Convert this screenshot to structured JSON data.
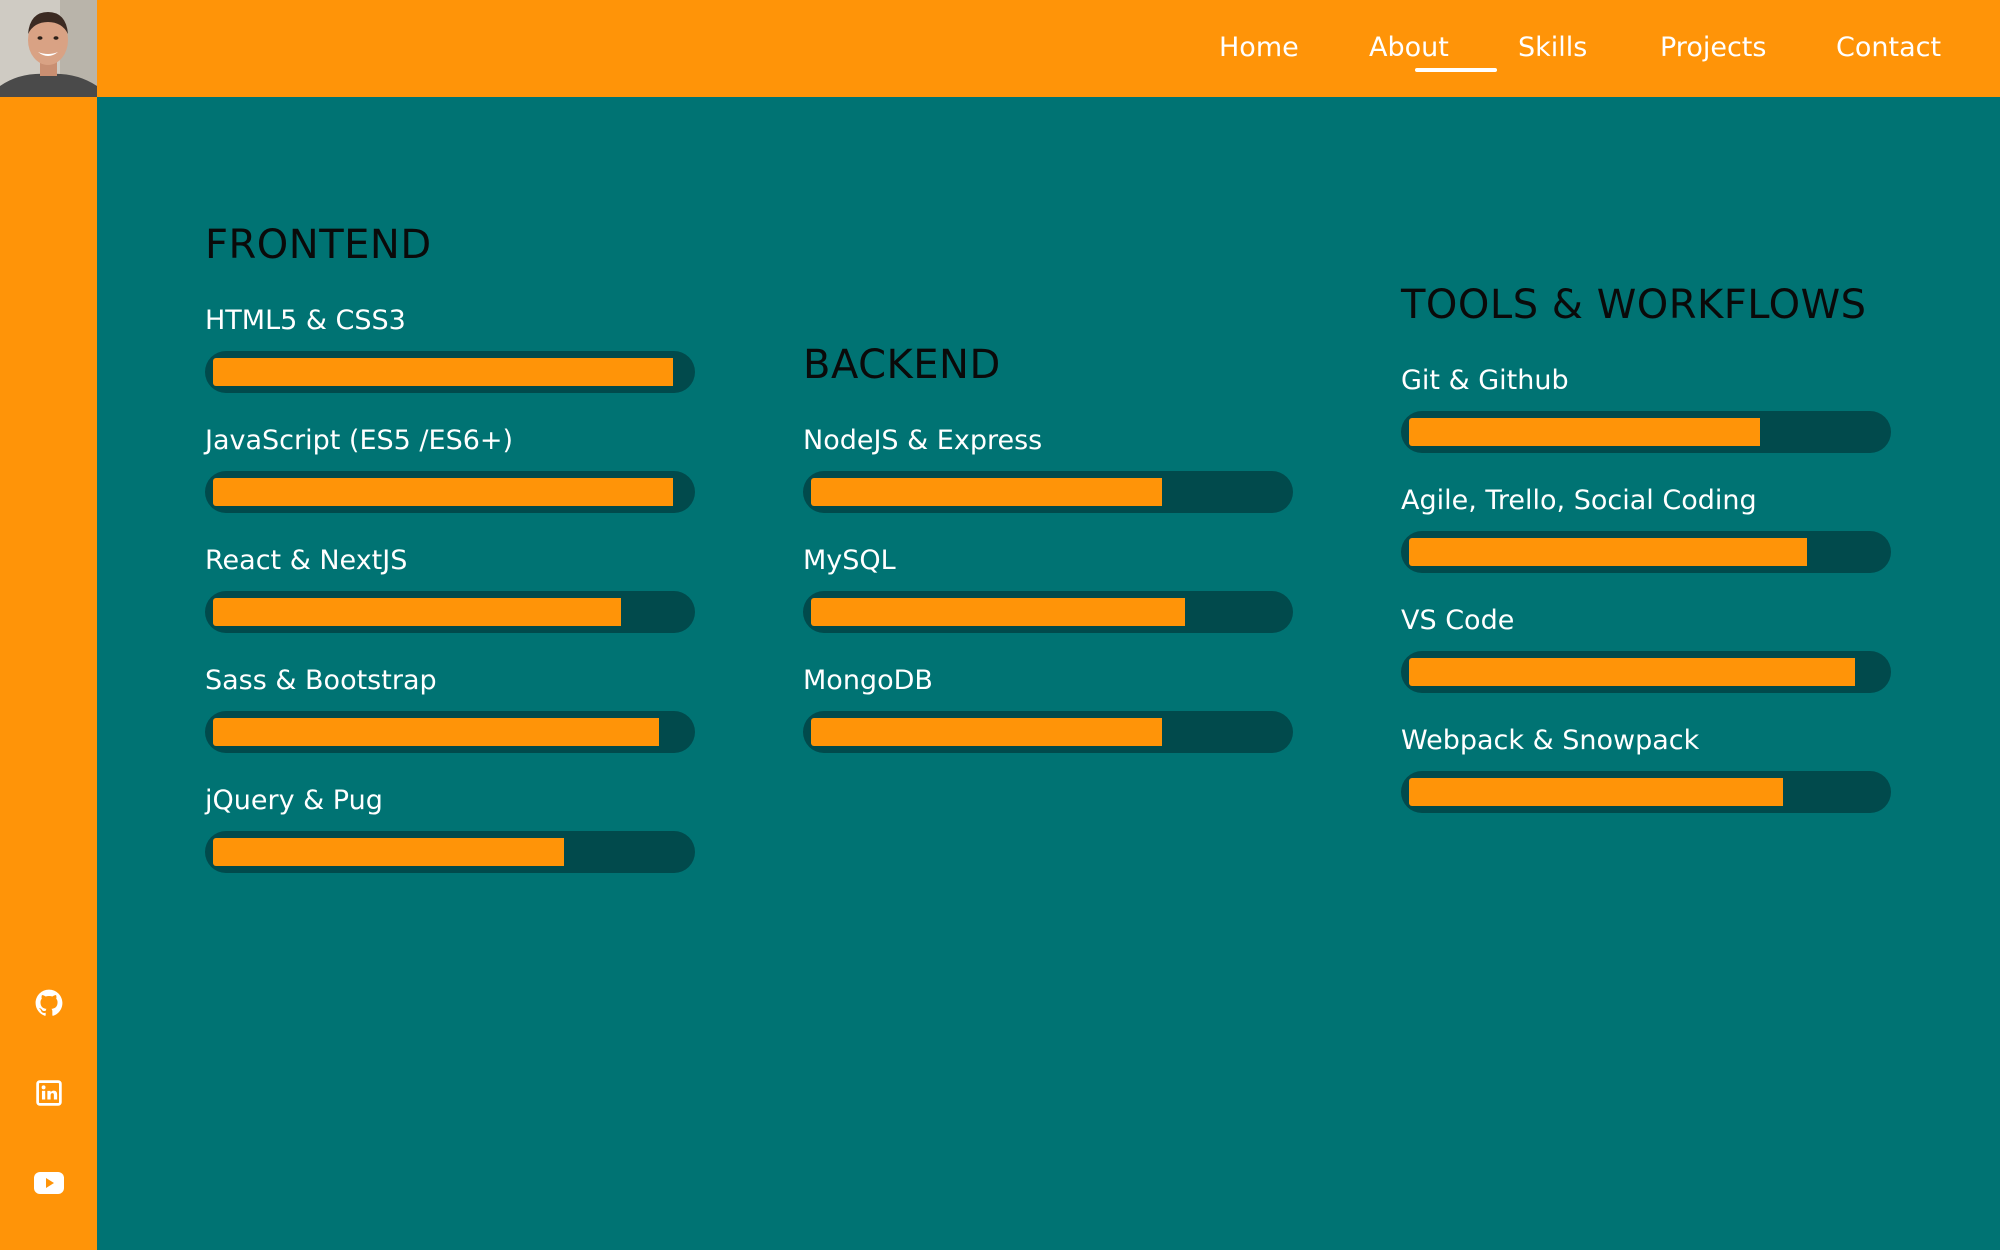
{
  "colors": {
    "accent": "#FF9408",
    "background": "#007373",
    "track": "#014A4C",
    "text": "#FFFFFF",
    "heading": "#0A0A0A"
  },
  "sidebar": {
    "avatar_alt": "profile photo",
    "social": [
      {
        "icon": "github-icon"
      },
      {
        "icon": "linkedin-icon"
      },
      {
        "icon": "youtube-icon"
      }
    ]
  },
  "nav": {
    "active": "Skills",
    "links": [
      "Home",
      "About",
      "Skills",
      "Projects",
      "Contact"
    ]
  },
  "skills": {
    "frontend": {
      "heading": "FRONTEND",
      "items": [
        {
          "label": "HTML5 & CSS3",
          "level": 97
        },
        {
          "label": "JavaScript (ES5 /ES6+)",
          "level": 97
        },
        {
          "label": "React & NextJS",
          "level": 86
        },
        {
          "label": "Sass & Bootstrap",
          "level": 94
        },
        {
          "label": "jQuery & Pug",
          "level": 74
        }
      ]
    },
    "backend": {
      "heading": "BACKEND",
      "items": [
        {
          "label": "NodeJS & Express",
          "level": 74
        },
        {
          "label": "MySQL",
          "level": 79
        },
        {
          "label": "MongoDB",
          "level": 74
        }
      ]
    },
    "tools": {
      "heading": "TOOLS & WORKFLOWS",
      "items": [
        {
          "label": "Git & Github",
          "level": 74
        },
        {
          "label": "Agile, Trello, Social Coding",
          "level": 84
        },
        {
          "label": "VS Code",
          "level": 94
        },
        {
          "label": "Webpack & Snowpack",
          "level": 79
        }
      ]
    }
  }
}
